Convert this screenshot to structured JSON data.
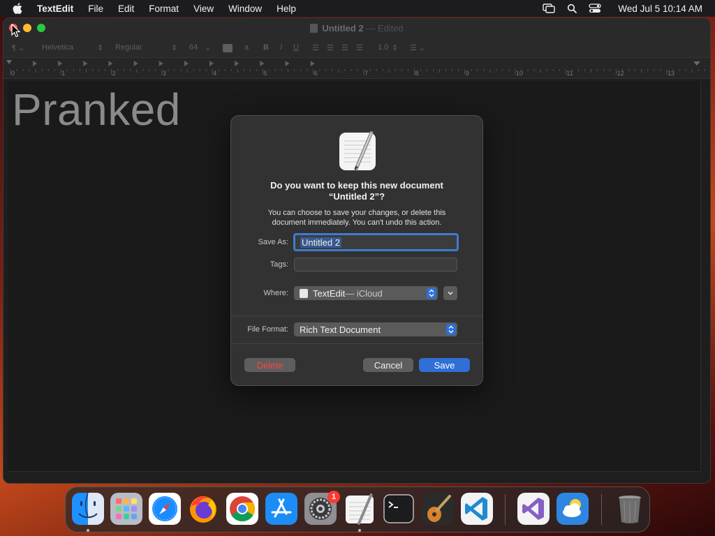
{
  "menubar": {
    "app_name": "TextEdit",
    "items": [
      "File",
      "Edit",
      "Format",
      "View",
      "Window",
      "Help"
    ],
    "clock": "Wed Jul 5  10:14 AM"
  },
  "window": {
    "title": "Untitled 2",
    "edited": "— Edited"
  },
  "toolbar": {
    "paragraph_style": "¶",
    "font_family": "Helvetica",
    "font_style": "Regular",
    "font_size": "64",
    "spacing": "1.0",
    "text_style_a": "a",
    "bold": "B",
    "italic": "I",
    "underline": "U"
  },
  "ruler": {
    "numbers": [
      "0",
      "1",
      "2",
      "3",
      "4",
      "5",
      "6",
      "7",
      "8",
      "9",
      "10",
      "11",
      "12",
      "13"
    ]
  },
  "document": {
    "text": "Pranked"
  },
  "dialog": {
    "title_line1": "Do you want to keep this new document",
    "title_line2": "“Untitled 2”?",
    "message_line1": "You can choose to save your changes, or delete this",
    "message_line2": "document immediately. You can't undo this action.",
    "save_as_label": "Save As:",
    "save_as_value": "Untitled 2",
    "tags_label": "Tags:",
    "tags_value": "",
    "where_label": "Where:",
    "where_app": "TextEdit",
    "where_location": " — iCloud",
    "file_format_label": "File Format:",
    "file_format_value": "Rich Text Document",
    "delete_label": "Delete",
    "cancel_label": "Cancel",
    "save_label": "Save"
  },
  "dock": {
    "apps": [
      "Finder",
      "Launchpad",
      "Safari",
      "Firefox",
      "Google Chrome",
      "App Store",
      "System Settings",
      "TextEdit",
      "Terminal",
      "GarageBand",
      "Visual Studio Code",
      "Visual Studio",
      "Weather",
      "Trash"
    ],
    "system_settings_badge": "1"
  },
  "colors": {
    "accent": "#2f6fd6",
    "delete": "#ff453a",
    "badge": "#ff3b30"
  }
}
